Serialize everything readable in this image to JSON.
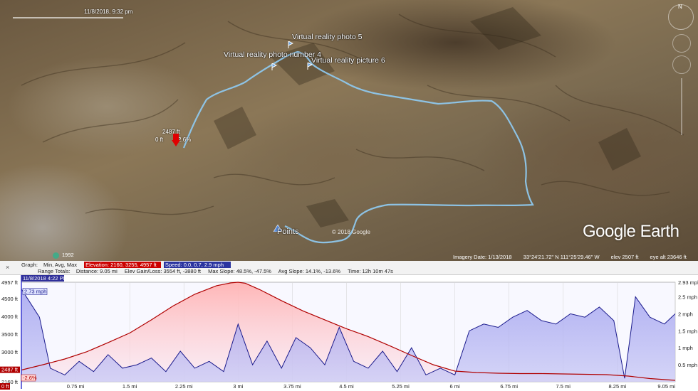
{
  "map": {
    "time_slider_date": "11/8/2018, 9:32 pm",
    "placemarks": [
      {
        "label": "Virtual reality photo 5"
      },
      {
        "label": "Virtual reality photo number 4"
      },
      {
        "label": "Virtual reality picture 6"
      },
      {
        "label": "Points"
      }
    ],
    "elevation_marker": {
      "elev": "2487 ft",
      "dist": "0 ft",
      "slope": "-2.6%"
    },
    "compass_label": "N",
    "logo": {
      "brand": "Google",
      "product": "Earth"
    },
    "copyright": "© 2018 Google",
    "historical_year": "1992",
    "status": {
      "imagery_date": "Imagery Date: 1/13/2018",
      "coords": "33°24'21.72\" N   111°25'29.46\" W",
      "elev": "elev  2507 ft",
      "eye_alt": "eye alt  23646 ft"
    }
  },
  "profile": {
    "stats": {
      "graph_label": "Graph:",
      "graph_cols": "Min, Avg, Max",
      "elevation_sel": "Elevation: 2160, 3255, 4957 ft",
      "speed_sel": "Speed: 0.0, 0.7, 2.9 mph",
      "range_label": "Range Totals:",
      "distance": "Distance: 9.05 mi",
      "gain_loss": "Elev Gain/Loss: 3554 ft, -3880 ft",
      "max_slope": "Max Slope: 48.5%, -47.5%",
      "avg_slope": "Avg Slope: 14.1%, -13.6%",
      "time": "Time: 12h 10m 47s"
    },
    "cursor": {
      "timestamp": "11/8/2018 4:22 PM",
      "speed": "2.73 mph",
      "elev": "2487 ft",
      "slope": "-2.6%",
      "dist": "0 ft"
    },
    "end_label": "9.05 mi"
  },
  "chart_data": {
    "type": "area",
    "x_unit": "mi",
    "x_ticks": [
      "0.75 mi",
      "1.5 mi",
      "2.25 mi",
      "3 mi",
      "3.75 mi",
      "4.5 mi",
      "5.25 mi",
      "6 mi",
      "6.75 mi",
      "7.5 mi",
      "8.25 mi",
      "9.05 mi"
    ],
    "y_left_ticks": [
      "4957 ft",
      "4500 ft",
      "4000 ft",
      "3500 ft",
      "3000 ft",
      "2500 ft",
      "2160 ft"
    ],
    "y_right_ticks": [
      "2.93 mph",
      "2.5 mph",
      "2 mph",
      "1.5 mph",
      "1 mph",
      "0.5 mph"
    ],
    "ylim_left": [
      2160,
      4957
    ],
    "ylim_right": [
      0,
      2.93
    ],
    "xlim": [
      0,
      9.05
    ],
    "colors": {
      "elevation": "#b00000",
      "elevation_fill": "#ffb3b3",
      "speed": "#1a1a8c",
      "speed_fill": "#9999ee"
    },
    "series": [
      {
        "name": "Elevation",
        "x": [
          0,
          0.3,
          0.6,
          0.9,
          1.2,
          1.5,
          1.8,
          2.1,
          2.4,
          2.7,
          2.9,
          3.0,
          3.1,
          3.3,
          3.6,
          3.9,
          4.2,
          4.5,
          4.8,
          5.1,
          5.4,
          5.7,
          6.0,
          6.3,
          6.6,
          6.9,
          7.2,
          7.5,
          7.8,
          8.1,
          8.4,
          8.7,
          9.05
        ],
        "values": [
          2490,
          2640,
          2800,
          3000,
          3260,
          3530,
          3900,
          4290,
          4620,
          4860,
          4940,
          4957,
          4930,
          4750,
          4440,
          4150,
          3900,
          3650,
          3430,
          3170,
          2900,
          2640,
          2460,
          2420,
          2400,
          2390,
          2390,
          2380,
          2370,
          2360,
          2320,
          2250,
          2200
        ]
      },
      {
        "name": "Speed",
        "x": [
          0,
          0.1,
          0.25,
          0.4,
          0.6,
          0.8,
          1.0,
          1.2,
          1.4,
          1.6,
          1.8,
          2.0,
          2.2,
          2.4,
          2.6,
          2.8,
          3.0,
          3.2,
          3.4,
          3.6,
          3.8,
          4.0,
          4.2,
          4.4,
          4.6,
          4.8,
          5.0,
          5.2,
          5.4,
          5.6,
          5.8,
          6.0,
          6.2,
          6.4,
          6.6,
          6.8,
          7.0,
          7.2,
          7.4,
          7.6,
          7.8,
          8.0,
          8.2,
          8.35,
          8.5,
          8.7,
          8.9,
          9.05
        ],
        "values": [
          2.73,
          2.4,
          1.9,
          0.4,
          0.2,
          0.6,
          0.3,
          0.8,
          0.4,
          0.5,
          0.7,
          0.3,
          0.9,
          0.4,
          0.6,
          0.3,
          1.7,
          0.5,
          1.2,
          0.4,
          1.3,
          1.0,
          0.5,
          1.6,
          0.6,
          0.4,
          0.9,
          0.3,
          1.0,
          0.2,
          0.4,
          0.2,
          1.5,
          1.7,
          1.6,
          1.9,
          2.1,
          1.8,
          1.7,
          2.0,
          1.9,
          2.2,
          1.8,
          0.1,
          2.5,
          1.9,
          1.7,
          2.0
        ]
      }
    ]
  }
}
